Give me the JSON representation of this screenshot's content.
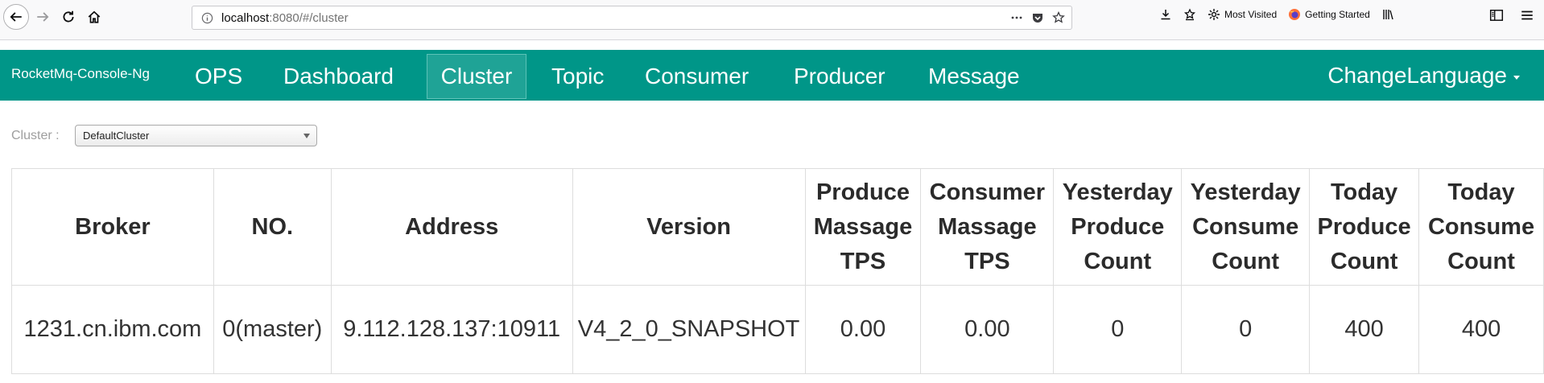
{
  "browser": {
    "url_host": "localhost",
    "url_rest": ":8080/#/cluster",
    "bookmarks": [
      {
        "label": "Most Visited",
        "icon": "gear-icon"
      },
      {
        "label": "Getting Started",
        "icon": "firefox-icon"
      }
    ]
  },
  "app": {
    "brand": "RocketMq-Console-Ng",
    "nav": [
      {
        "label": "OPS",
        "active": false
      },
      {
        "label": "Dashboard",
        "active": false
      },
      {
        "label": "Cluster",
        "active": true
      },
      {
        "label": "Topic",
        "active": false
      },
      {
        "label": "Consumer",
        "active": false
      },
      {
        "label": "Producer",
        "active": false
      },
      {
        "label": "Message",
        "active": false
      }
    ],
    "language": "ChangeLanguage",
    "accent_color": "#009688"
  },
  "cluster": {
    "label": "Cluster :",
    "selected": "DefaultCluster"
  },
  "table": {
    "headers": [
      [
        "Broker"
      ],
      [
        "NO."
      ],
      [
        "Address"
      ],
      [
        "Version"
      ],
      [
        "Produce",
        "Massage",
        "TPS"
      ],
      [
        "Consumer",
        "Massage",
        "TPS"
      ],
      [
        "Yesterday",
        "Produce",
        "Count"
      ],
      [
        "Yesterday",
        "Consume",
        "Count"
      ],
      [
        "Today",
        "Produce",
        "Count"
      ],
      [
        "Today",
        "Consume",
        "Count"
      ]
    ],
    "rows": [
      [
        "1231.cn.ibm.com",
        "0(master)",
        "9.112.128.137:10911",
        "V4_2_0_SNAPSHOT",
        "0.00",
        "0.00",
        "0",
        "0",
        "400",
        "400"
      ]
    ]
  }
}
